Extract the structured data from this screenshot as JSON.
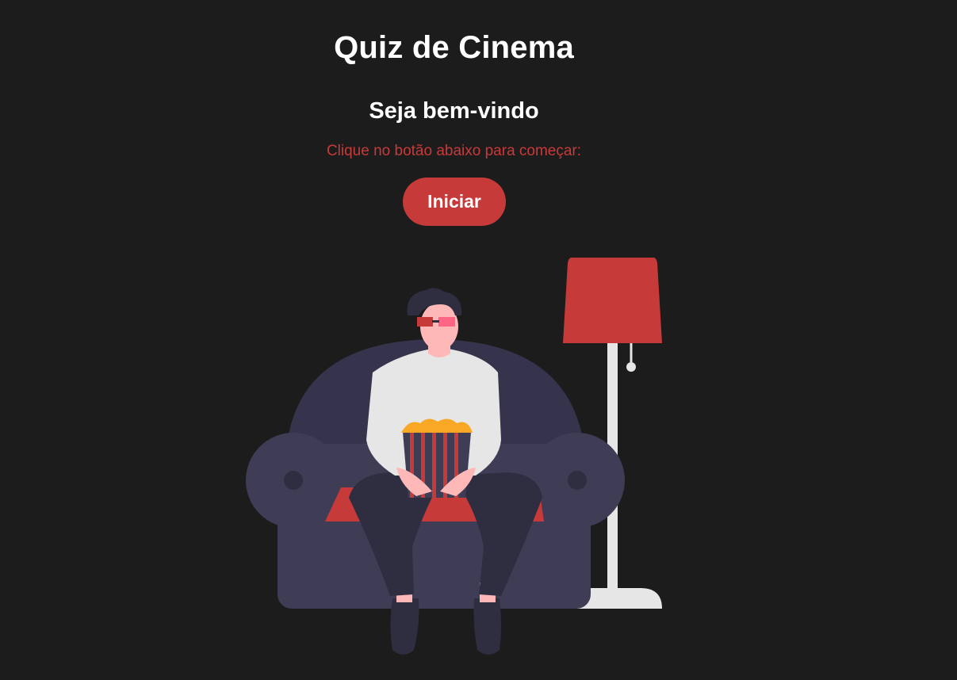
{
  "header": {
    "title": "Quiz de Cinema"
  },
  "main": {
    "welcome": "Seja bem-vindo",
    "instruction": "Clique no botão abaixo para começar:",
    "start_button_label": "Iniciar"
  },
  "illustration": {
    "subject": "person-watching-movie-illustration",
    "colors": {
      "background": "#1c1c1c",
      "accent": "#c63b3a",
      "sofa": "#3f3d56",
      "sofa_back": "#36344c",
      "shirt": "#e6e6e6",
      "pants": "#2f2e41",
      "skin": "#ffb8b8",
      "popcorn": "#f9a825",
      "lamp_pole": "#e6e6e6"
    }
  }
}
